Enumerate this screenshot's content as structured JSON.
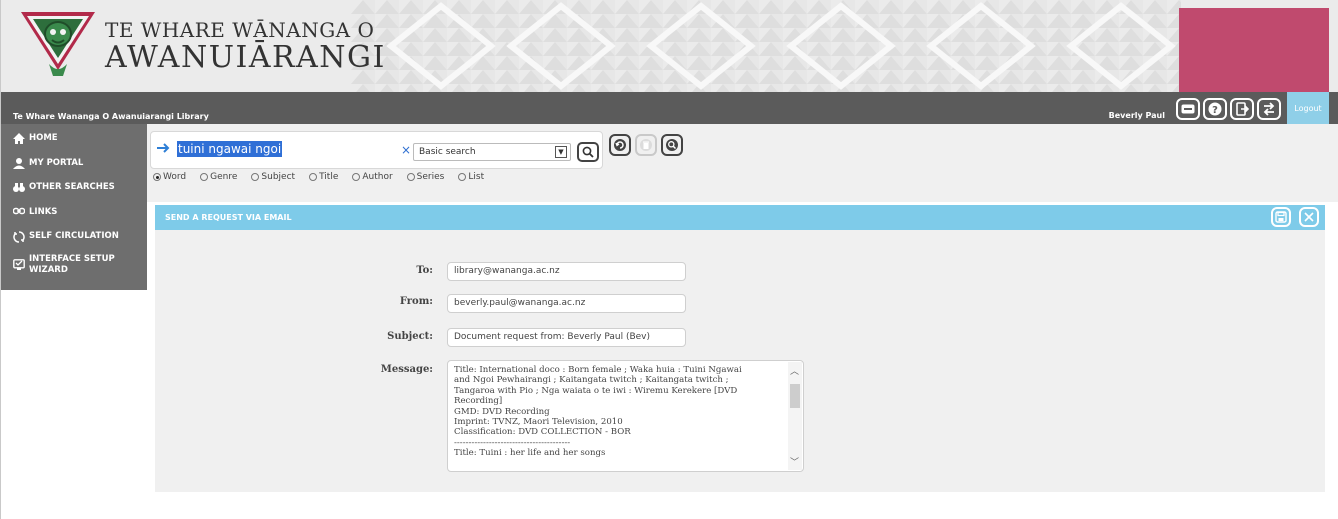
{
  "colors": {
    "topbar": "#5b5b5b",
    "sidebar": "#6e6e6e",
    "panel_header": "#7ecbe9",
    "accent_block": "#c04a6e",
    "query_highlight": "#2f6fd6"
  },
  "brand": {
    "line1": "TE WHARE WĀNANGA O",
    "line2": "AWANUIĀRANGI"
  },
  "topbar": {
    "library_name": "Te Whare Wananga O Awanuiarangi Library",
    "user_name": "Beverly Paul",
    "logout_label": "Logout",
    "icons": [
      "keyboard-icon",
      "help-icon",
      "logout-door-icon",
      "switch-icon"
    ]
  },
  "sidebar": {
    "items": [
      {
        "label": "HOME",
        "icon": "home-icon"
      },
      {
        "label": "MY PORTAL",
        "icon": "user-icon"
      },
      {
        "label": "OTHER SEARCHES",
        "icon": "binoculars-icon"
      },
      {
        "label": "LINKS",
        "icon": "link-icon"
      },
      {
        "label": "SELF CIRCULATION",
        "icon": "circulation-icon"
      },
      {
        "label": "INTERFACE SETUP WIZARD",
        "icon": "monitor-icon"
      }
    ]
  },
  "search": {
    "query": "tuini ngawai ngoi",
    "clear": "×",
    "search_type": "Basic search",
    "options": [
      {
        "label": "Word",
        "selected": true
      },
      {
        "label": "Genre",
        "selected": false
      },
      {
        "label": "Subject",
        "selected": false
      },
      {
        "label": "Title",
        "selected": false
      },
      {
        "label": "Author",
        "selected": false
      },
      {
        "label": "Series",
        "selected": false
      },
      {
        "label": "List",
        "selected": false
      }
    ]
  },
  "panel": {
    "title": "SEND A REQUEST VIA EMAIL",
    "form": {
      "to_label": "To:",
      "to_value": "library@wananga.ac.nz",
      "from_label": "From:",
      "from_value": "beverly.paul@wananga.ac.nz",
      "subject_label": "Subject:",
      "subject_value": "Document request from: Beverly Paul (Bev)",
      "message_label": "Message:",
      "message_value": "Title: International doco : Born female ; Waka huia : Tuini Ngawai\nand Ngoi Pewhairangi ; Kaitangata twitch ; Kaitangata twitch ;\nTangaroa with Pio ; Nga waiata o te iwi : Wiremu Kerekere [DVD\nRecording]\nGMD: DVD Recording\nImprint: TVNZ, Maori Television, 2010\nClassification: DVD COLLECTION - BOR\n----------------------------------------\nTitle: Tuini : her life and her songs"
    }
  }
}
